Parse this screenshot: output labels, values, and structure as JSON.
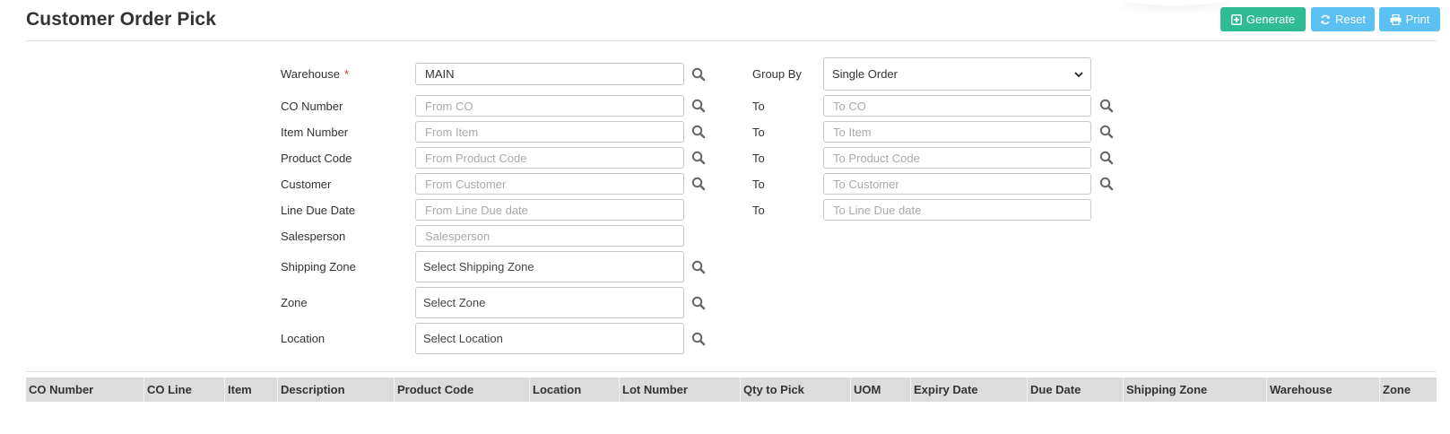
{
  "header": {
    "title": "Customer Order Pick",
    "buttons": {
      "generate": "Generate",
      "reset": "Reset",
      "print": "Print"
    }
  },
  "form": {
    "warehouse": {
      "label": "Warehouse",
      "required_mark": "*",
      "value": "MAIN"
    },
    "group_by": {
      "label": "Group By",
      "value": "Single Order"
    },
    "to_label": "To",
    "co_number": {
      "label": "CO Number",
      "from_placeholder": "From CO",
      "to_placeholder": "To CO"
    },
    "item_number": {
      "label": "Item Number",
      "from_placeholder": "From Item",
      "to_placeholder": "To Item"
    },
    "product_code": {
      "label": "Product Code",
      "from_placeholder": "From Product Code",
      "to_placeholder": "To Product Code"
    },
    "customer": {
      "label": "Customer",
      "from_placeholder": "From Customer",
      "to_placeholder": "To Customer"
    },
    "line_due_date": {
      "label": "Line Due Date",
      "from_placeholder": "From Line Due date",
      "to_placeholder": "To Line Due date"
    },
    "salesperson": {
      "label": "Salesperson",
      "placeholder": "Salesperson"
    },
    "shipping_zone": {
      "label": "Shipping Zone",
      "value": "Select Shipping Zone"
    },
    "zone": {
      "label": "Zone",
      "value": "Select Zone"
    },
    "location": {
      "label": "Location",
      "value": "Select Location"
    }
  },
  "grid": {
    "columns": [
      "CO Number",
      "CO Line",
      "Item",
      "Description",
      "Product Code",
      "Location",
      "Lot Number",
      "Qty to Pick",
      "UOM",
      "Expiry Date",
      "Due Date",
      "Shipping Zone",
      "Warehouse",
      "Zone"
    ]
  },
  "colors": {
    "generate": "#2fbc94",
    "reset": "#5bc0f2",
    "print": "#5bc0f2",
    "required": "#e33333"
  }
}
